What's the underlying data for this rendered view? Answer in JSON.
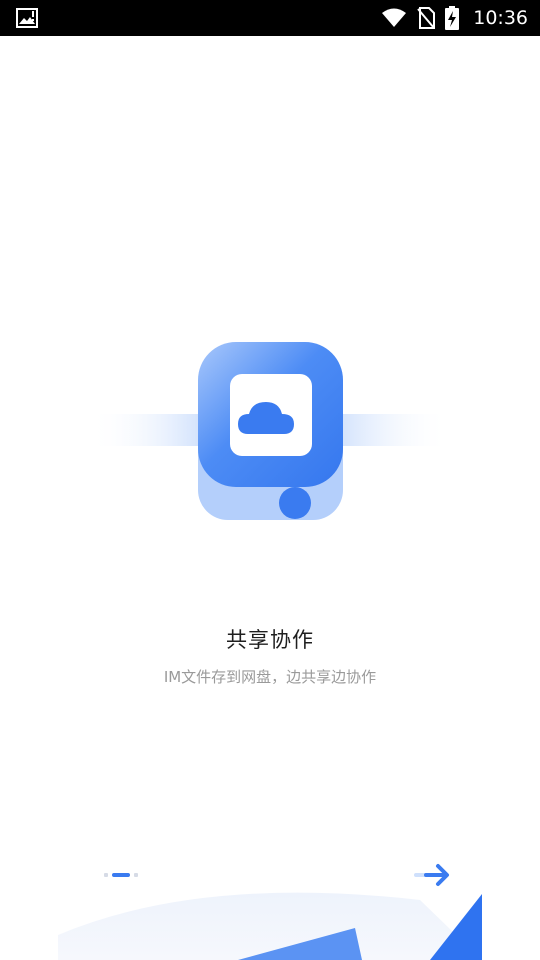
{
  "status_bar": {
    "time": "10:36",
    "icons": [
      "gallery-icon",
      "wifi-icon",
      "no-sim-icon",
      "battery-charging-icon"
    ]
  },
  "onboarding": {
    "illustration_icon": "cloud-icon",
    "title": "共享协作",
    "subtitle": "IM文件存到网盘，边共享边协作",
    "page_indicator": {
      "current": 2,
      "total": 3
    },
    "next_icon": "arrow-right-icon"
  },
  "colors": {
    "accent": "#3a7bf0",
    "accent_light": "#aecbfa",
    "title": "#1f1f1f",
    "subtitle": "#9a9a9a"
  }
}
